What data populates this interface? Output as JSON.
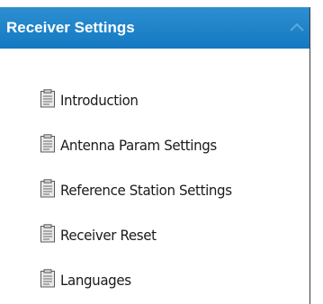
{
  "panel": {
    "title": "Receiver Settings",
    "collapse_icon": "chevron-up-icon",
    "header_color": "#1a84c9",
    "items": [
      {
        "label": "Introduction",
        "icon": "document-icon"
      },
      {
        "label": "Antenna Param Settings",
        "icon": "document-icon"
      },
      {
        "label": "Reference Station Settings",
        "icon": "document-icon"
      },
      {
        "label": "Receiver Reset",
        "icon": "document-icon"
      },
      {
        "label": "Languages",
        "icon": "document-icon"
      }
    ]
  }
}
